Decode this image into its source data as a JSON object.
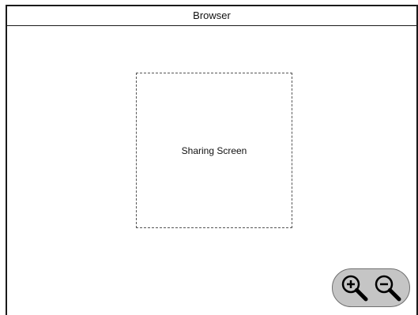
{
  "window": {
    "title": "Browser"
  },
  "share_area": {
    "label": "Sharing Screen"
  },
  "zoom": {
    "zoom_in_icon": "zoom-in-icon",
    "zoom_out_icon": "zoom-out-icon",
    "background_color": "#c5c5c5"
  }
}
